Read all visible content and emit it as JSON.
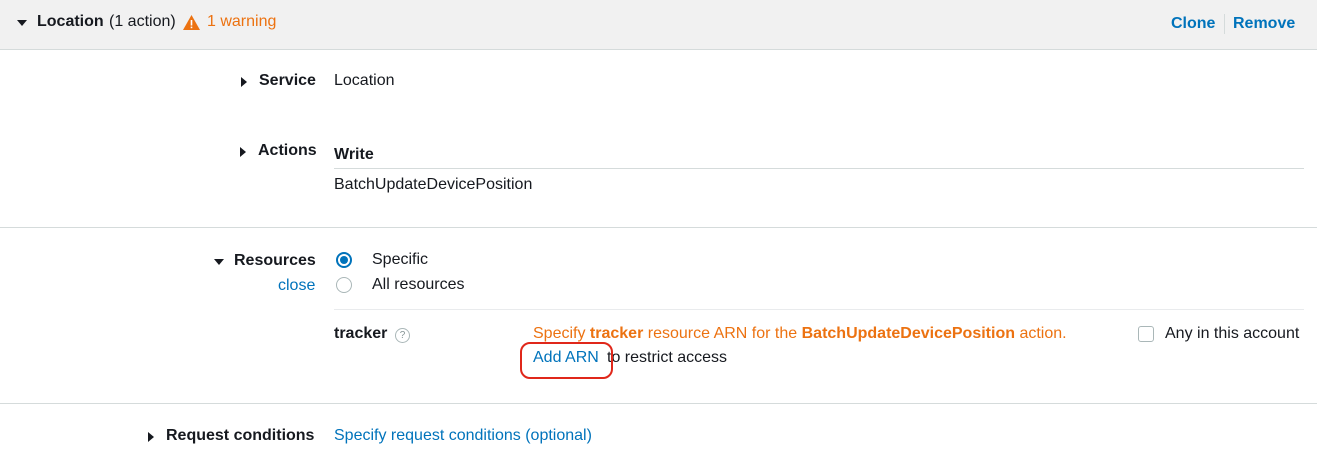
{
  "header": {
    "title": "Location",
    "action_count": "(1 action)",
    "warning_text": "1 warning",
    "clone_label": "Clone",
    "remove_label": "Remove"
  },
  "service": {
    "label": "Service",
    "value": "Location"
  },
  "actions": {
    "label": "Actions",
    "group": "Write",
    "item": "BatchUpdateDevicePosition"
  },
  "resources": {
    "label": "Resources",
    "close_label": "close",
    "options": [
      "Specific",
      "All resources"
    ],
    "selected": "Specific",
    "tracker": {
      "label": "tracker",
      "info_icon": "?",
      "msg_prefix": "Specify",
      "msg_bold_1": "tracker",
      "msg_middle": "resource ARN for the",
      "msg_bold_2": "BatchUpdateDevicePosition",
      "msg_suffix": "action.",
      "add_arn_label": "Add ARN",
      "restrict_text": "to restrict access",
      "any_account_label": "Any in this account"
    }
  },
  "request_conditions": {
    "label": "Request conditions",
    "link": "Specify request conditions (optional)"
  },
  "colors": {
    "link": "#0073bb",
    "warning": "#ec7211",
    "highlight": "#e0271a"
  }
}
